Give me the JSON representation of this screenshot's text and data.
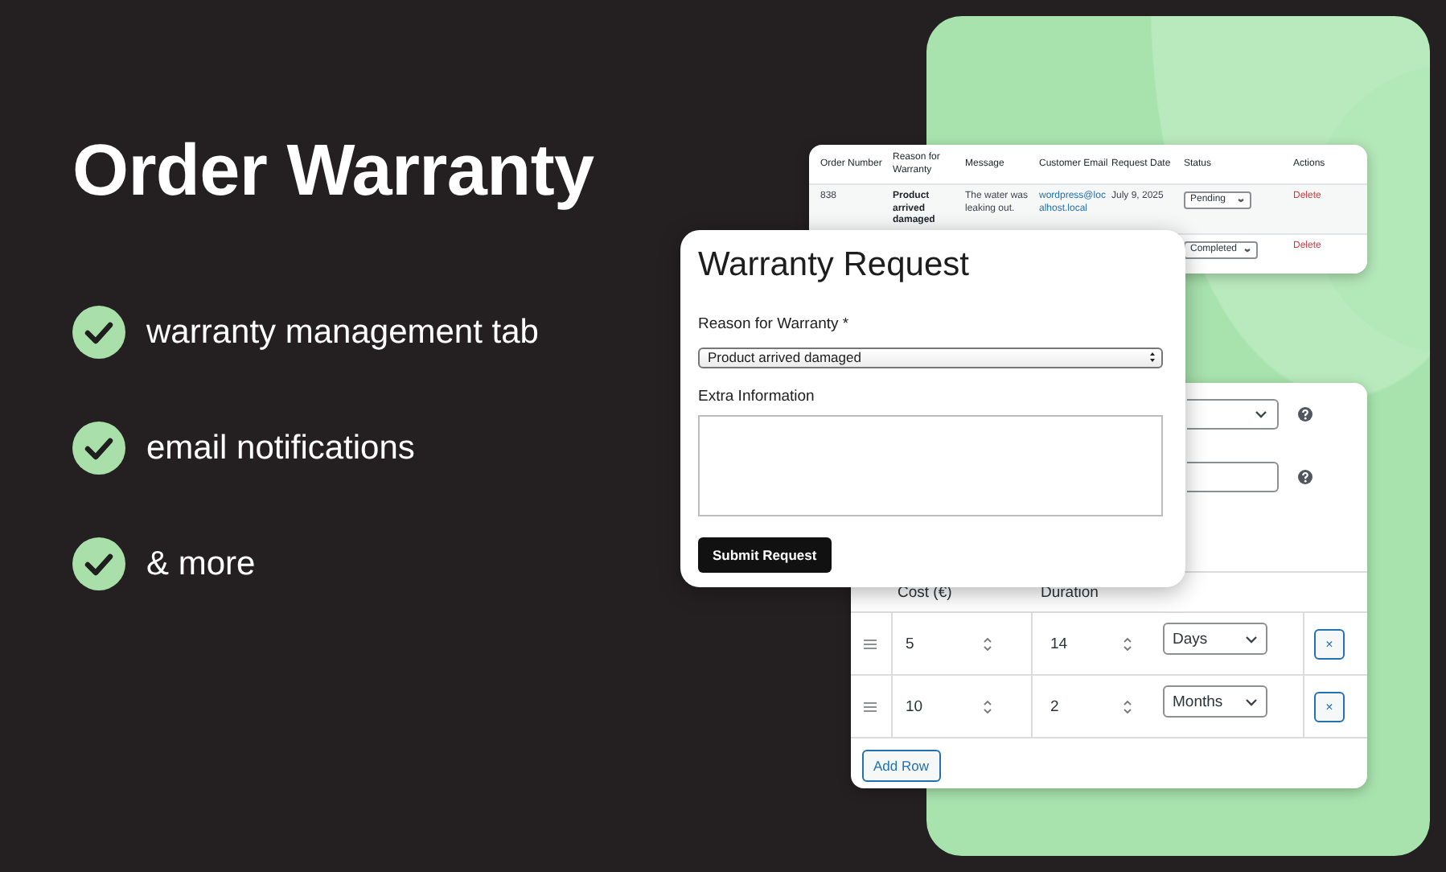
{
  "headline": "Order Warranty",
  "features": [
    {
      "text": "warranty management tab"
    },
    {
      "text": "email notifications"
    },
    {
      "text": "& more"
    }
  ],
  "orders_table": {
    "columns": [
      "Order Number",
      "Reason for Warranty",
      "Message",
      "Customer Email",
      "Request Date",
      "Status",
      "Actions"
    ],
    "rows": [
      {
        "order_number": "838",
        "reason": "Product arrived damaged",
        "message": "The water was leaking out.",
        "email": "wordpress@localhost.local",
        "date": "July 9, 2025",
        "status": "Pending",
        "action": "Delete"
      },
      {
        "status": "Completed",
        "action": "Delete"
      }
    ]
  },
  "warranty_form": {
    "title": "Warranty Request",
    "reason_label": "Reason for Warranty *",
    "reason_value": "Product arrived damaged",
    "extra_label": "Extra Information",
    "submit": "Submit Request"
  },
  "settings": {
    "fields": [
      {
        "kind": "select"
      },
      {
        "kind": "input"
      }
    ],
    "columns": [
      "Cost (€)",
      "Duration"
    ],
    "rows": [
      {
        "cost": "5",
        "duration": "14",
        "unit": "Days",
        "remove": "×"
      },
      {
        "cost": "10",
        "duration": "2",
        "unit": "Months",
        "remove": "×"
      }
    ],
    "add_row": "Add Row"
  }
}
